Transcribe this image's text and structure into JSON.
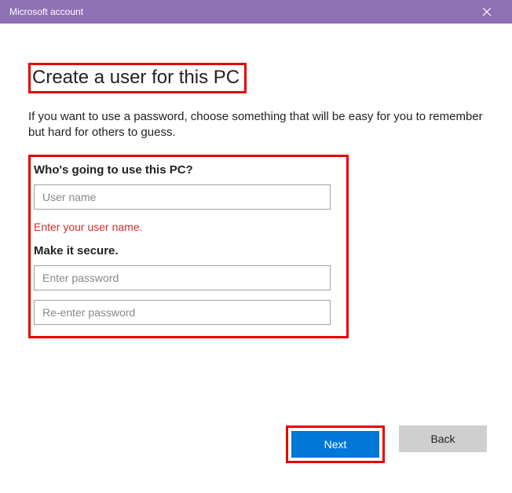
{
  "window": {
    "title": "Microsoft account"
  },
  "main": {
    "heading": "Create a user for this PC",
    "description": "If you want to use a password, choose something that will be easy for you to remember but hard for others to guess."
  },
  "form": {
    "who_label": "Who's going to use this PC?",
    "username_placeholder": "User name",
    "username_value": "",
    "username_error": "Enter your user name.",
    "secure_label": "Make it secure.",
    "password_placeholder": "Enter password",
    "password_value": "",
    "reenter_password_placeholder": "Re-enter password",
    "reenter_password_value": ""
  },
  "buttons": {
    "next": "Next",
    "back": "Back"
  },
  "colors": {
    "titlebar": "#8e70b5",
    "primary": "#0078d7",
    "error": "#d62e2e",
    "highlight": "#e60000"
  }
}
